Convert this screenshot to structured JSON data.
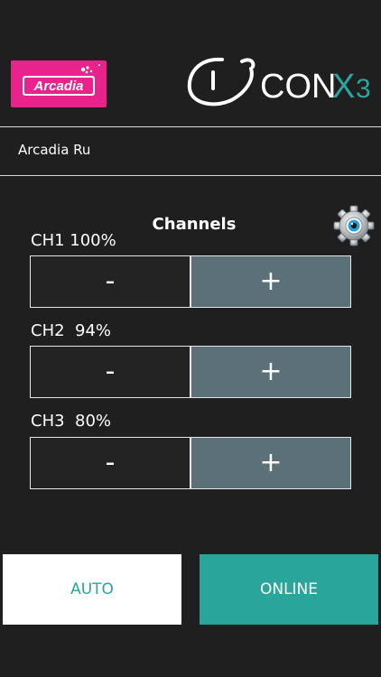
{
  "header": {
    "brand_logo_text": "Arcadia",
    "product_logo_text": "CONX3"
  },
  "device": {
    "name": "Arcadia Ru"
  },
  "channels_section": {
    "title": "Channels",
    "settings_icon": "gear-icon"
  },
  "channels": [
    {
      "label": "CH1 100%",
      "level_percent": 100,
      "decrease_label": "-",
      "increase_label": "+"
    },
    {
      "label": "CH2  94%",
      "level_percent": 94,
      "decrease_label": "-",
      "increase_label": "+"
    },
    {
      "label": "CH3  80%",
      "level_percent": 80,
      "decrease_label": "-",
      "increase_label": "+"
    }
  ],
  "modes": {
    "auto_label": "AUTO",
    "online_label": "ONLINE"
  },
  "colors": {
    "background": "#1f1f1f",
    "brand_pink": "#e8248c",
    "accent_teal": "#2aa59c",
    "plus_button": "#5b7079"
  }
}
